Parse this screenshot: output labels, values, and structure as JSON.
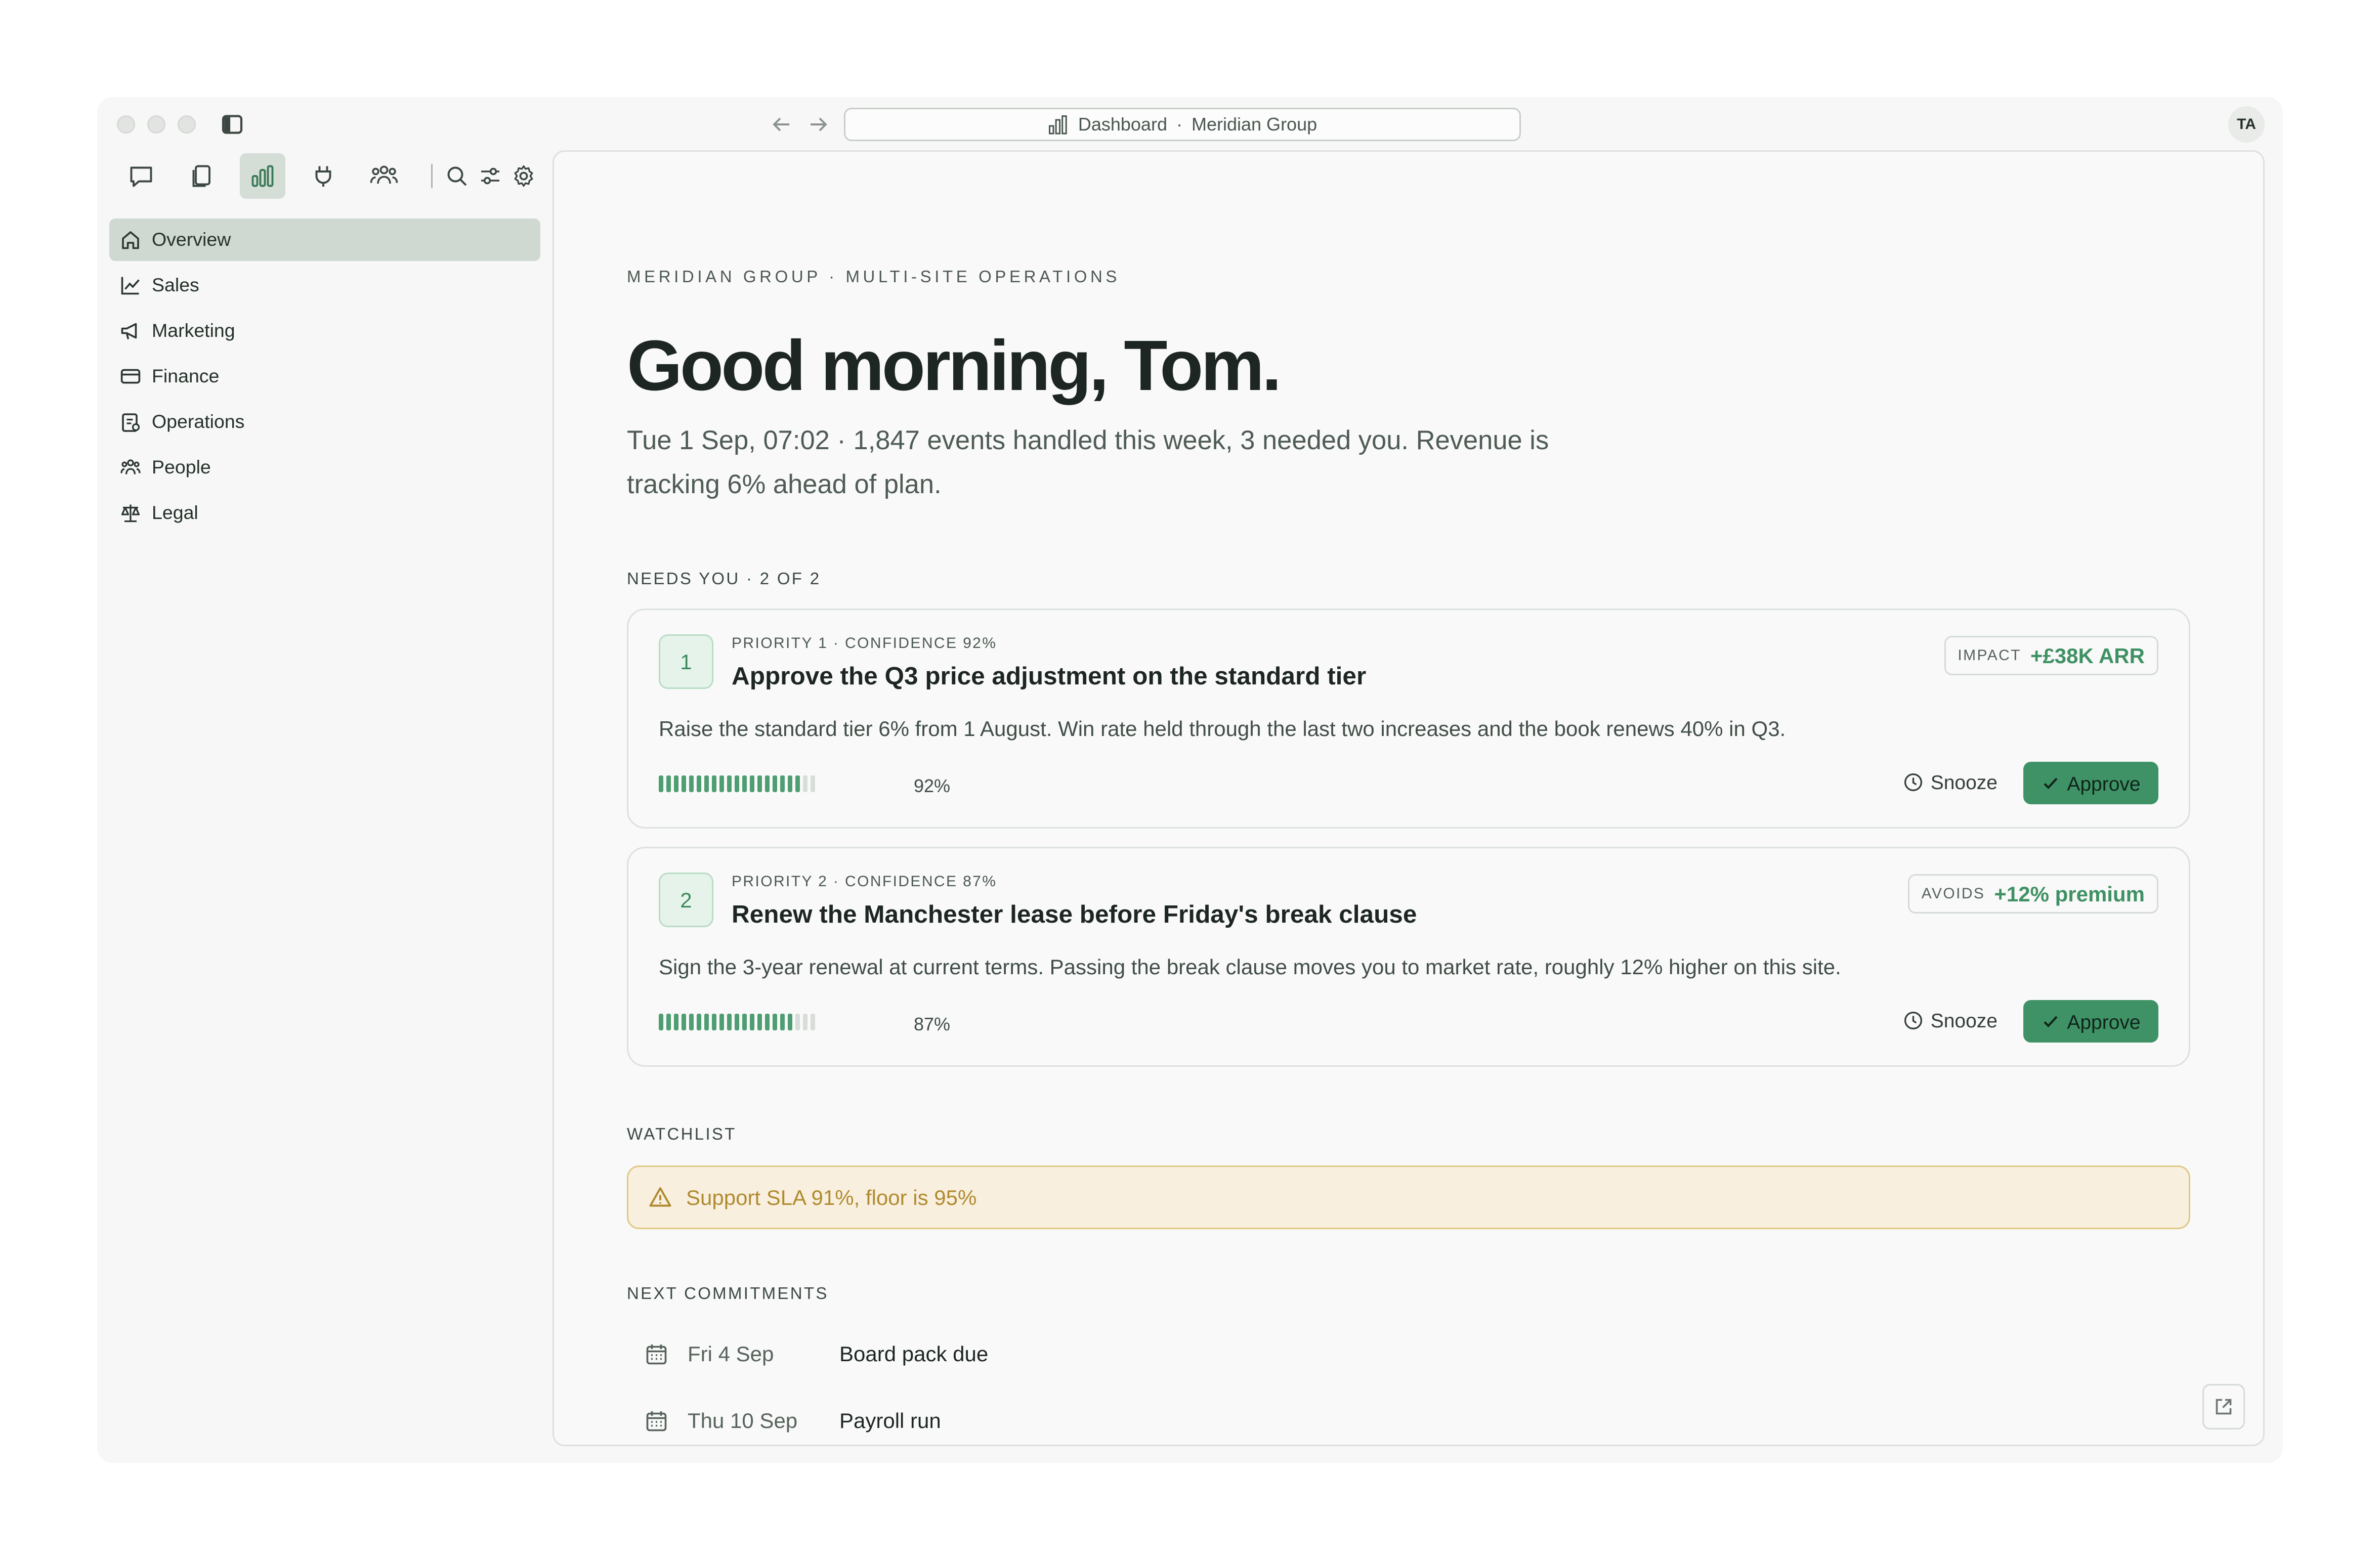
{
  "address_bar": {
    "section": "Dashboard",
    "separator": "·",
    "org": "Meridian Group"
  },
  "user": {
    "initials": "TA"
  },
  "sidebar": {
    "items": [
      {
        "label": "Overview",
        "icon": "home-icon",
        "active": true
      },
      {
        "label": "Sales",
        "icon": "line-chart-icon"
      },
      {
        "label": "Marketing",
        "icon": "megaphone-icon"
      },
      {
        "label": "Finance",
        "icon": "credit-card-icon"
      },
      {
        "label": "Operations",
        "icon": "clipboard-icon"
      },
      {
        "label": "People",
        "icon": "people-icon"
      },
      {
        "label": "Legal",
        "icon": "scales-icon"
      }
    ]
  },
  "toolbar": {
    "icons": [
      "chat-icon",
      "documents-icon",
      "bar-chart-icon",
      "plug-icon",
      "team-icon",
      "search-icon",
      "sliders-icon",
      "gear-icon"
    ]
  },
  "main": {
    "eyebrow": "MERIDIAN GROUP · MULTI-SITE OPERATIONS",
    "greeting": "Good morning, Tom.",
    "summary": "Tue 1 Sep, 07:02 · 1,847 events handled this week, 3 needed you. Revenue is tracking 6% ahead of plan.",
    "needs_label": "NEEDS YOU · 2 OF 2",
    "cards": [
      {
        "number": "1",
        "meta": "PRIORITY 1 · CONFIDENCE 92%",
        "title": "Approve the Q3 price adjustment on the standard tier",
        "description": "Raise the standard tier 6% from 1 August. Win rate held through the last two increases and the book renews 40% in Q3.",
        "impact_label": "IMPACT",
        "impact_value": "+£38K ARR",
        "confidence": 0.92,
        "confidence_label": "92%",
        "snooze_label": "Snooze",
        "approve_label": "Approve"
      },
      {
        "number": "2",
        "meta": "PRIORITY 2 · CONFIDENCE 87%",
        "title": "Renew the Manchester lease before Friday's break clause",
        "description": "Sign the 3-year renewal at current terms. Passing the break clause moves you to market rate, roughly 12% higher on this site.",
        "impact_label": "AVOIDS",
        "impact_value": "+12% premium",
        "confidence": 0.87,
        "confidence_label": "87%",
        "snooze_label": "Snooze",
        "approve_label": "Approve"
      }
    ],
    "watchlist_label": "WATCHLIST",
    "watchlist": [
      {
        "text": "Support SLA 91%, floor is 95%"
      }
    ],
    "commitments_label": "NEXT COMMITMENTS",
    "commitments": [
      {
        "date": "Fri 4 Sep",
        "title": "Board pack due"
      },
      {
        "date": "Thu 10 Sep",
        "title": "Payroll run"
      }
    ]
  },
  "colors": {
    "accent": "#3f9266",
    "warning_bg": "#f8efdf",
    "warning_text": "#b08a2e"
  }
}
